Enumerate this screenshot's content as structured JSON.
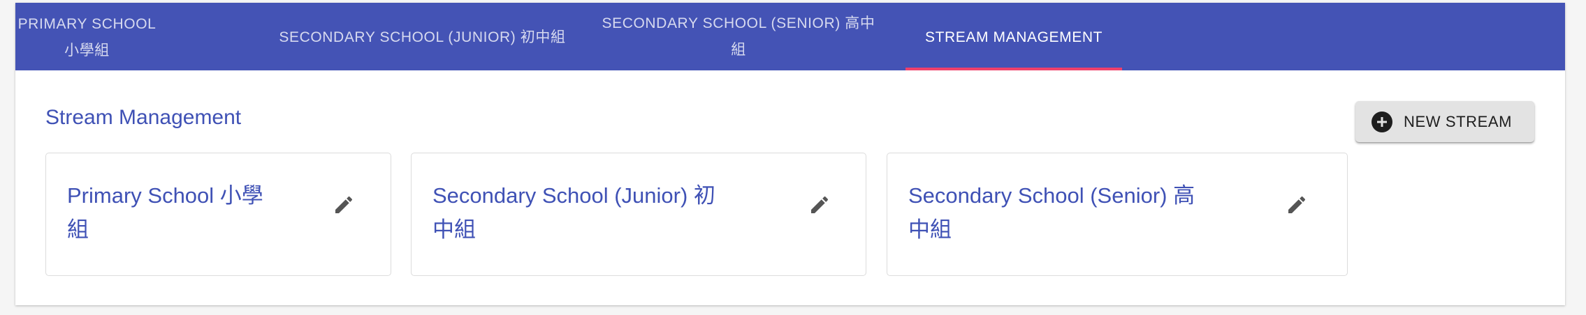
{
  "tabs": [
    {
      "label": "PRIMARY SCHOOL 小學組",
      "active": false
    },
    {
      "label": "SECONDARY SCHOOL (JUNIOR) 初中組",
      "active": false
    },
    {
      "label_line1": "SECONDARY SCHOOL (SENIOR) 高中",
      "label_line2": "組",
      "active": false
    },
    {
      "label": "STREAM MANAGEMENT",
      "active": true
    }
  ],
  "page": {
    "title": "Stream Management",
    "new_button_label": "NEW STREAM",
    "new_button_icon": "add-circle-icon"
  },
  "streams": [
    {
      "line1": "Primary School 小學",
      "line2": "組",
      "icon": "pencil-icon"
    },
    {
      "line1": "Secondary School (Junior) 初",
      "line2": "中組",
      "icon": "pencil-icon"
    },
    {
      "line1": "Secondary School (Senior) 高",
      "line2": "中組",
      "icon": "pencil-icon"
    }
  ],
  "colors": {
    "tabbar": "#4453b5",
    "indicator": "#f0406b",
    "accent_text": "#3f51b5"
  }
}
